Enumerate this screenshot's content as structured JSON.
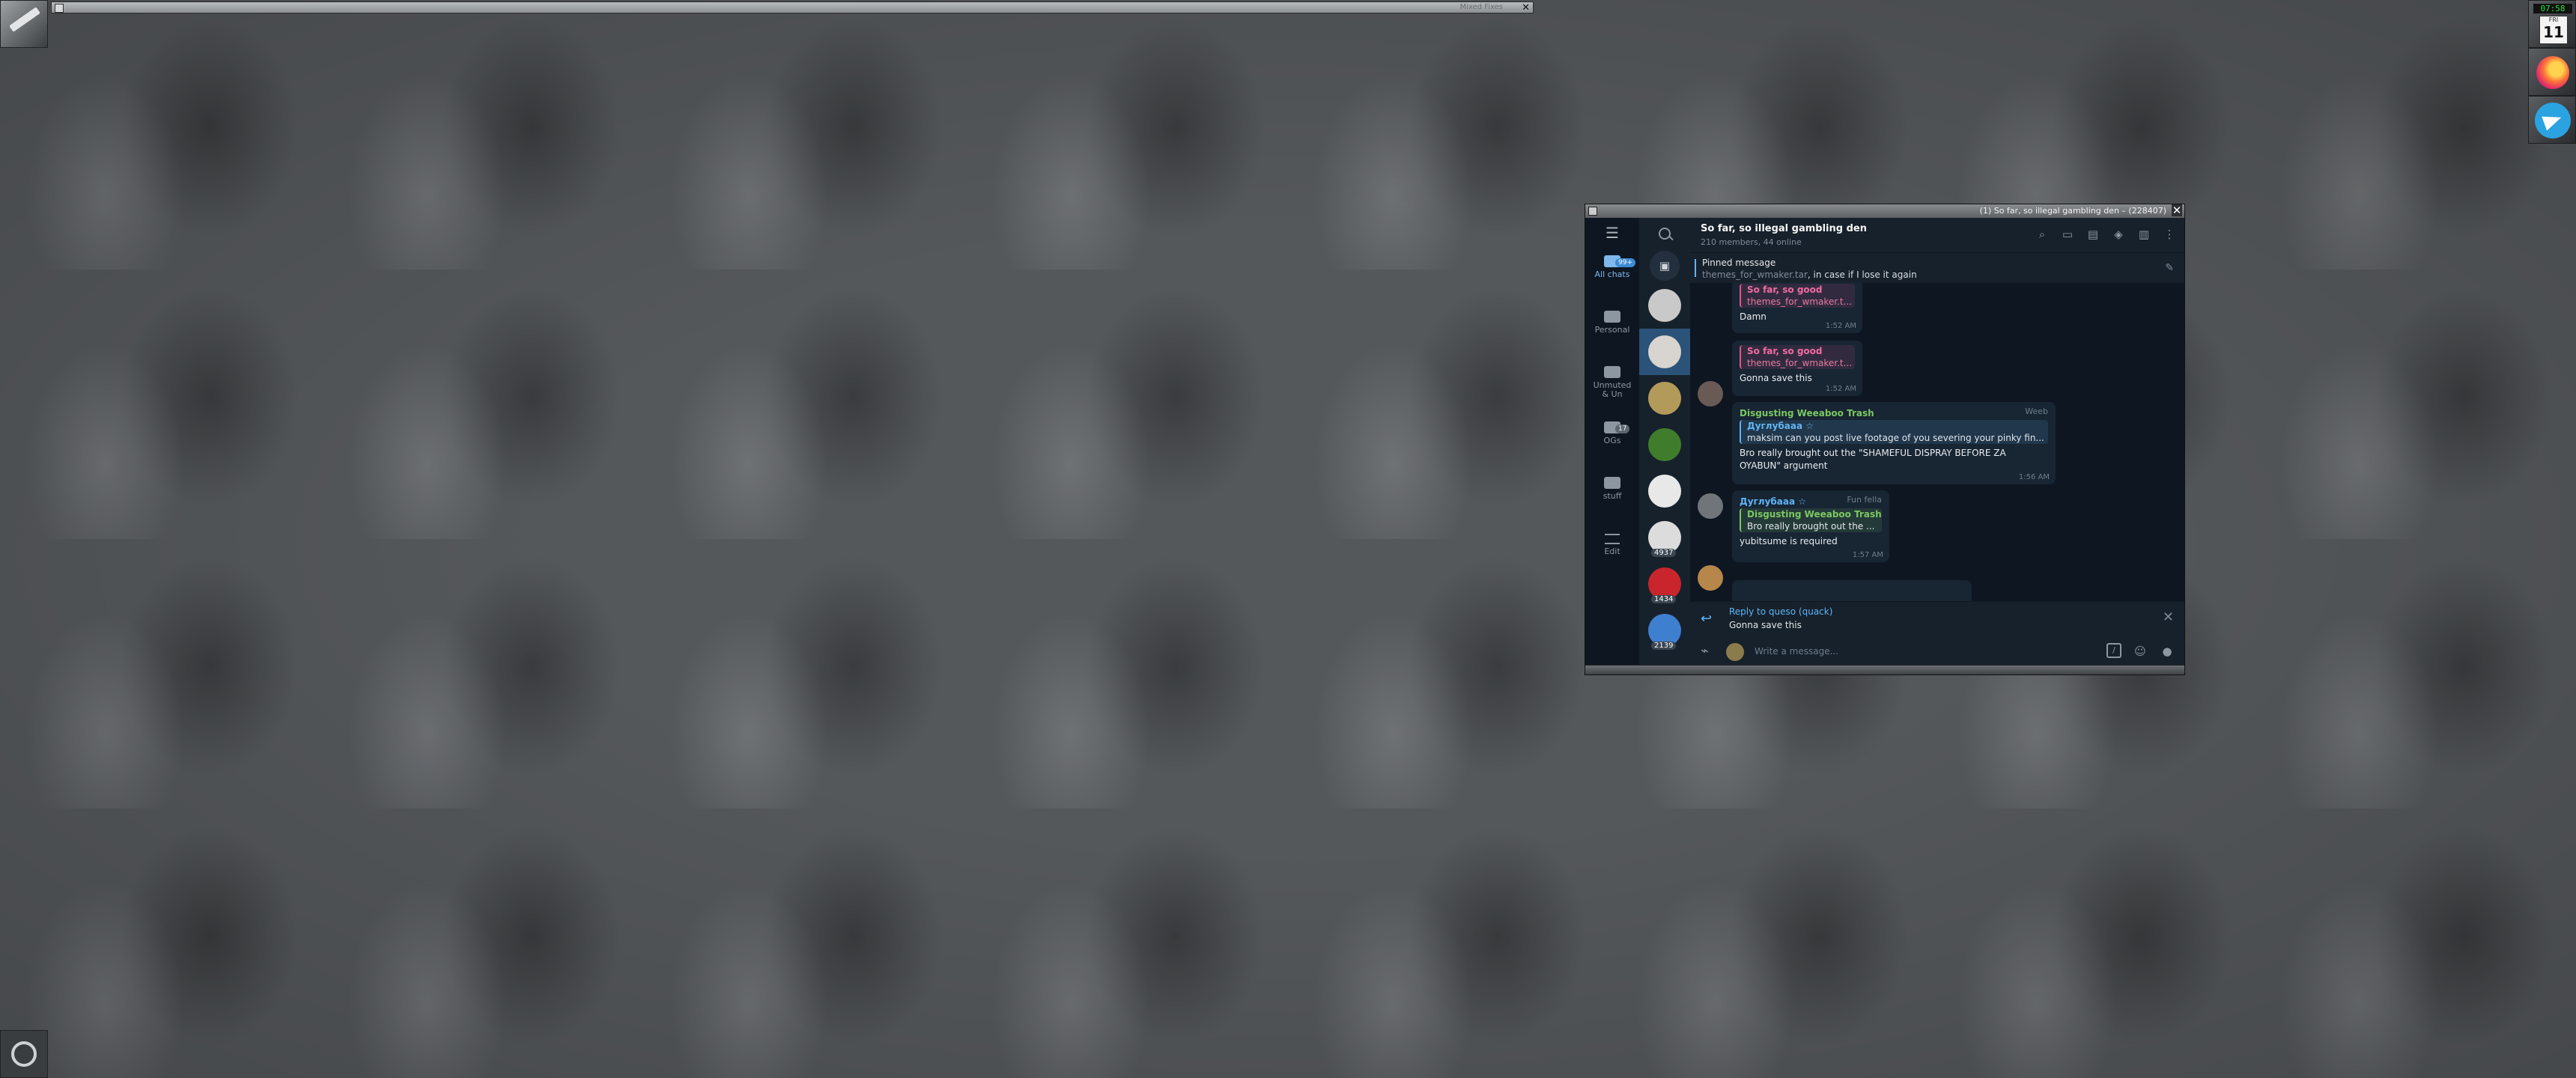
{
  "desktop": {
    "top_bar_title": "Mixed Fixes",
    "clock": {
      "time": "07:58",
      "dow": "FRI",
      "day": "11"
    }
  },
  "window": {
    "title": "(1) So far, so illegal gambling den – (228407)",
    "close_glyph": "✕"
  },
  "folders": [
    {
      "name": "All chats",
      "badge": "99+",
      "active": true
    },
    {
      "name": "Personal",
      "badge": ""
    },
    {
      "name": "Unmuted\n& Un",
      "badge": ""
    },
    {
      "name": "OGs",
      "badge": "17"
    },
    {
      "name": "stuff",
      "badge": ""
    },
    {
      "name": "Edit",
      "badge": ""
    }
  ],
  "chats": [
    {
      "color": "#c9c9c9",
      "count": ""
    },
    {
      "color": "#d8d4cf",
      "count": "",
      "active": true
    },
    {
      "color": "#b29a5a",
      "count": ""
    },
    {
      "color": "#3f7d2d",
      "count": ""
    },
    {
      "color": "#e8e8e8",
      "count": ""
    },
    {
      "color": "#dcdcdc",
      "count": "4937"
    },
    {
      "color": "#c8262c",
      "count": "1434"
    },
    {
      "color": "#3f7fd0",
      "count": "2139"
    }
  ],
  "header": {
    "title": "So far, so illegal gambling den",
    "subtitle": "210 members, 44 online",
    "icons": [
      "search-icon",
      "comments-icon",
      "calendar-icon",
      "shield-icon",
      "sidebar-icon",
      "more-icon"
    ]
  },
  "pinned": {
    "title": "Pinned message",
    "link": "themes_for_wmaker.tar",
    "text": ", in case if I lose it again"
  },
  "messages": {
    "m1": {
      "reply_name": "So far, so good",
      "reply_text": "themes_for_wmaker.t...",
      "text": "Damn",
      "time": "1:52 AM"
    },
    "m2": {
      "reply_name": "So far, so good",
      "reply_text": "themes_for_wmaker.t...",
      "text": "Gonna save this",
      "time": "1:52 AM"
    },
    "m3": {
      "sender": "Disgusting Weeaboo Trash",
      "rank": "Weeb",
      "reply_name": "Дуглубааа ☆",
      "reply_text": "maksim can you post live footage of you severing your pinky fin...",
      "text": "Bro really brought out the \"SHAMEFUL DISPRAY BEFORE ZA OYABUN\" argument",
      "time": "1:56 AM"
    },
    "m4": {
      "sender": "Дуглубааа ☆",
      "rank": "Fun fella",
      "reply_name": "Disgusting Weeaboo Trash",
      "reply_text": "Bro really brought out the ...",
      "text": "yubitsume is required",
      "time": "1:57 AM"
    }
  },
  "reply_bar": {
    "name": "Reply to queso (quack)",
    "text": "Gonna save this"
  },
  "composer": {
    "placeholder": "Write a message..."
  },
  "colors": {
    "accent": "#5eb5f7",
    "bg": "#0e1621",
    "panel": "#17212b",
    "bubble": "#182533"
  }
}
